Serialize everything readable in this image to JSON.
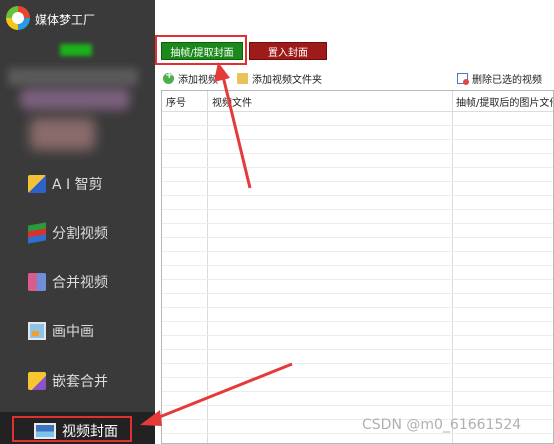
{
  "app": {
    "title": "媒体梦工厂"
  },
  "sidebar": {
    "items": [
      {
        "label": "A I 智剪",
        "icon": "ai-cut-icon"
      },
      {
        "label": "分割视频",
        "icon": "split-video-icon"
      },
      {
        "label": "合并视频",
        "icon": "merge-video-icon"
      },
      {
        "label": "画中画",
        "icon": "picture-in-picture-icon"
      },
      {
        "label": "嵌套合并",
        "icon": "nest-merge-icon"
      },
      {
        "label": "视频封面",
        "icon": "video-cover-icon",
        "active": true
      }
    ]
  },
  "main": {
    "buttons": {
      "extract": "抽帧/提取封面",
      "set_cover": "置入封面"
    },
    "toolbar": {
      "add_video": "添加视频",
      "add_folder": "添加视频文件夹",
      "delete_selected": "删除已选的视频"
    },
    "table": {
      "columns": [
        "序号",
        "视频文件",
        "抽帧/提取后的图片文件"
      ]
    }
  },
  "watermark": "CSDN @m0_61661524",
  "colors": {
    "sidebar_bg": "#3a3a3a",
    "extract_button": "#1a8a1a",
    "set_cover_button": "#a01a1a",
    "highlight": "#e03030"
  }
}
